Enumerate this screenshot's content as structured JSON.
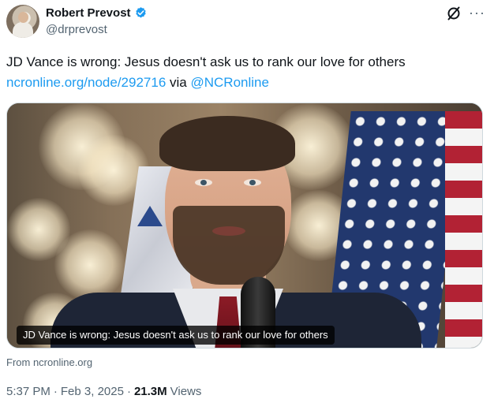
{
  "author": {
    "display_name": "Robert Prevost",
    "handle": "@drprevost",
    "verified_color": "#1d9bf0"
  },
  "tweet": {
    "text": "JD Vance is wrong: Jesus doesn't ask us to rank our love for others",
    "link_text": "ncronline.org/node/292716",
    "via_text": "via",
    "mention": "@NCRonline"
  },
  "card": {
    "caption": "JD Vance is wrong: Jesus doesn't ask us to rank our love for others",
    "source": "From ncronline.org"
  },
  "meta": {
    "time": "5:37 PM",
    "sep1": "·",
    "date": "Feb 3, 2025",
    "sep2": "·",
    "views_count": "21.3M",
    "views_label": "Views"
  },
  "icons": {
    "verified": "verified-badge-icon",
    "grok": "grok-icon",
    "more": "more-icon"
  },
  "colors": {
    "link": "#1d9bf0",
    "muted": "#536471",
    "text": "#0f1419"
  }
}
